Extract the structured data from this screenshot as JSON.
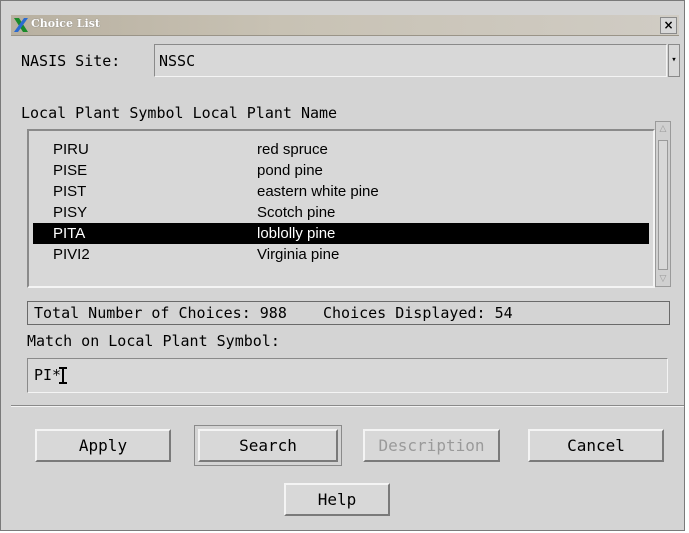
{
  "window": {
    "title": "Choice List",
    "close_glyph": "×"
  },
  "site": {
    "label": "NASIS Site:",
    "value": "NSSC",
    "dropdown_glyph": "▾"
  },
  "list": {
    "header": "Local Plant Symbol Local Plant Name",
    "rows": [
      {
        "symbol": "PIRU",
        "name": "red spruce",
        "selected": false
      },
      {
        "symbol": "PISE",
        "name": "pond pine",
        "selected": false
      },
      {
        "symbol": "PIST",
        "name": "eastern white pine",
        "selected": false
      },
      {
        "symbol": "PISY",
        "name": "Scotch pine",
        "selected": false
      },
      {
        "symbol": "PITA",
        "name": "loblolly pine",
        "selected": true
      },
      {
        "symbol": "PIVI2",
        "name": "Virginia pine",
        "selected": false
      }
    ]
  },
  "status": {
    "text": "Total Number of Choices: 988    Choices Displayed: 54"
  },
  "match": {
    "label": "Match on Local Plant Symbol:",
    "value": "PI*"
  },
  "buttons": {
    "apply": "Apply",
    "search": "Search",
    "description": "Description",
    "cancel": "Cancel",
    "help": "Help"
  },
  "colors": {
    "background": "#d4d4d4",
    "selection": "#000000",
    "selection_text": "#ffffff"
  }
}
